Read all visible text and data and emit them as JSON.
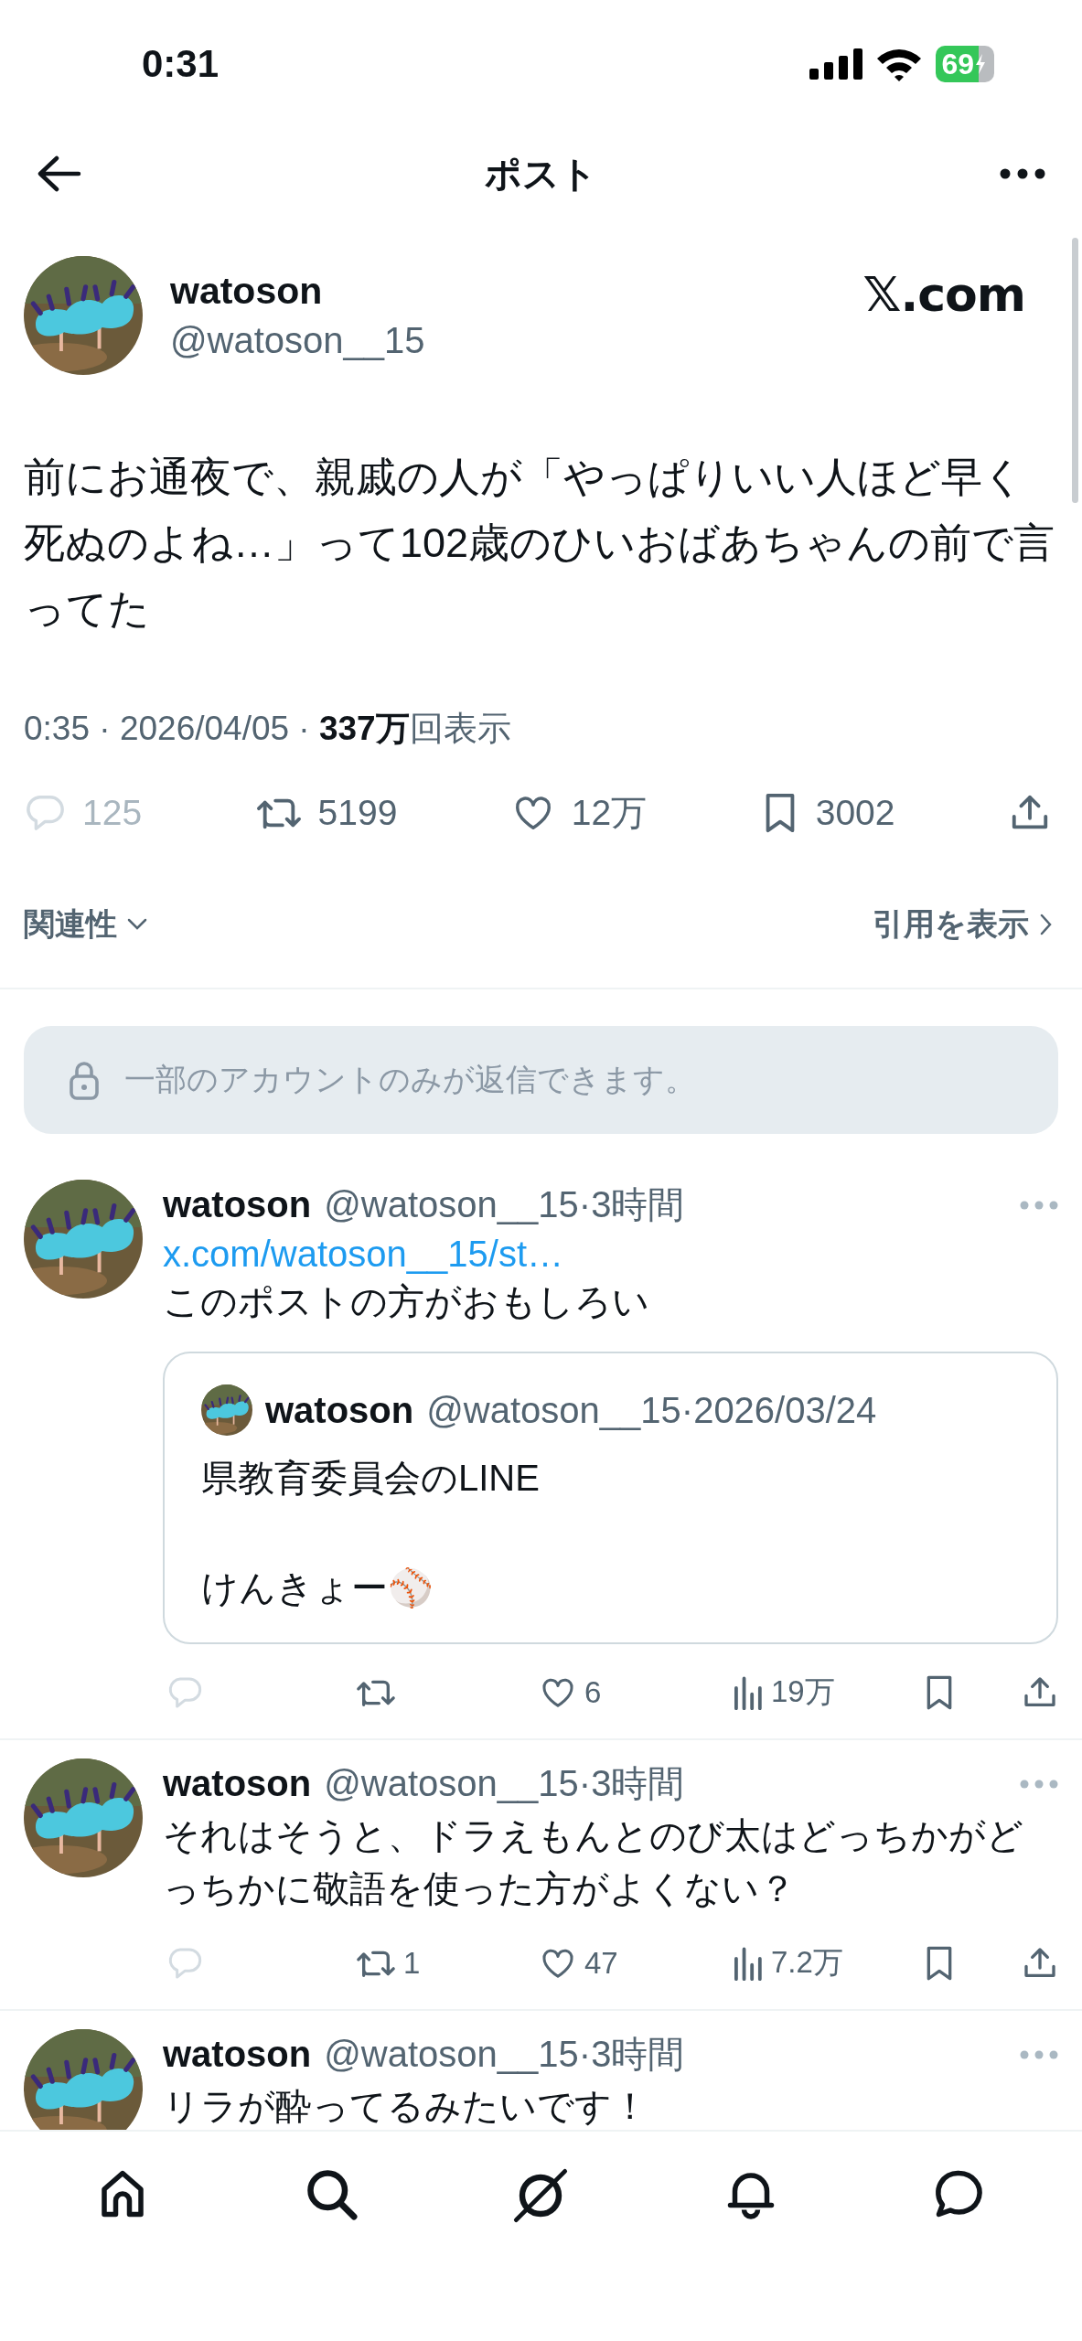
{
  "status_bar": {
    "time": "0:31",
    "battery": "69"
  },
  "header": {
    "title": "ポスト"
  },
  "post": {
    "name": "watoson",
    "handle": "@watoson__15",
    "source": "𝕏.com",
    "text": "前にお通夜で、親戚の人が「やっぱりいい人ほど早く死ぬのよね…」って102歳のひいおばあちゃんの前で言ってた",
    "meta": "0:35 · 2026/04/05 · **337万**回表示",
    "stats": [
      {
        "kind": "reply",
        "count": "125",
        "disabled": true
      },
      {
        "kind": "retweet",
        "count": "5199",
        "disabled": false
      },
      {
        "kind": "like",
        "count": "12万",
        "disabled": false
      },
      {
        "kind": "bookmark",
        "count": "3002",
        "disabled": false
      },
      {
        "kind": "share",
        "disabled": false
      }
    ]
  },
  "sort": {
    "label": "関連性",
    "quotes_link": "引用を表示"
  },
  "reply_notice": "一部のアカウントのみが返信できます。",
  "replies": [
    {
      "name": "watoson",
      "meta": "@watoson__15·3時間",
      "link": "x.com/watoson__15/st…",
      "text": "このポストの方がおもしろい",
      "quote": {
        "name": "watoson",
        "meta": "@watoson__15·2026/03/24",
        "text": "県教育委員会のLINE\n\nけんきょー⚾"
      },
      "stats": [
        {
          "kind": "reply",
          "disabled": true
        },
        {
          "kind": "retweet",
          "disabled": false
        },
        {
          "kind": "like",
          "count": "6",
          "disabled": false
        },
        {
          "kind": "views",
          "count": "19万",
          "disabled": false
        },
        {
          "kind": "bookmark",
          "disabled": false
        },
        {
          "kind": "share",
          "disabled": false
        }
      ]
    },
    {
      "name": "watoson",
      "meta": "@watoson__15·3時間",
      "text": "それはそうと、ドラえもんとのび太はどっちかがどっちかに敬語を使った方がよくない？",
      "stats": [
        {
          "kind": "reply",
          "disabled": true
        },
        {
          "kind": "retweet",
          "count": "1",
          "disabled": false
        },
        {
          "kind": "like",
          "count": "47",
          "disabled": false
        },
        {
          "kind": "views",
          "count": "7.2万",
          "disabled": false
        },
        {
          "kind": "bookmark",
          "disabled": false
        },
        {
          "kind": "share",
          "disabled": false
        }
      ]
    },
    {
      "name": "watoson",
      "meta": "@watoson__15·3時間",
      "text": "リラが酔ってるみたいです！"
    }
  ]
}
